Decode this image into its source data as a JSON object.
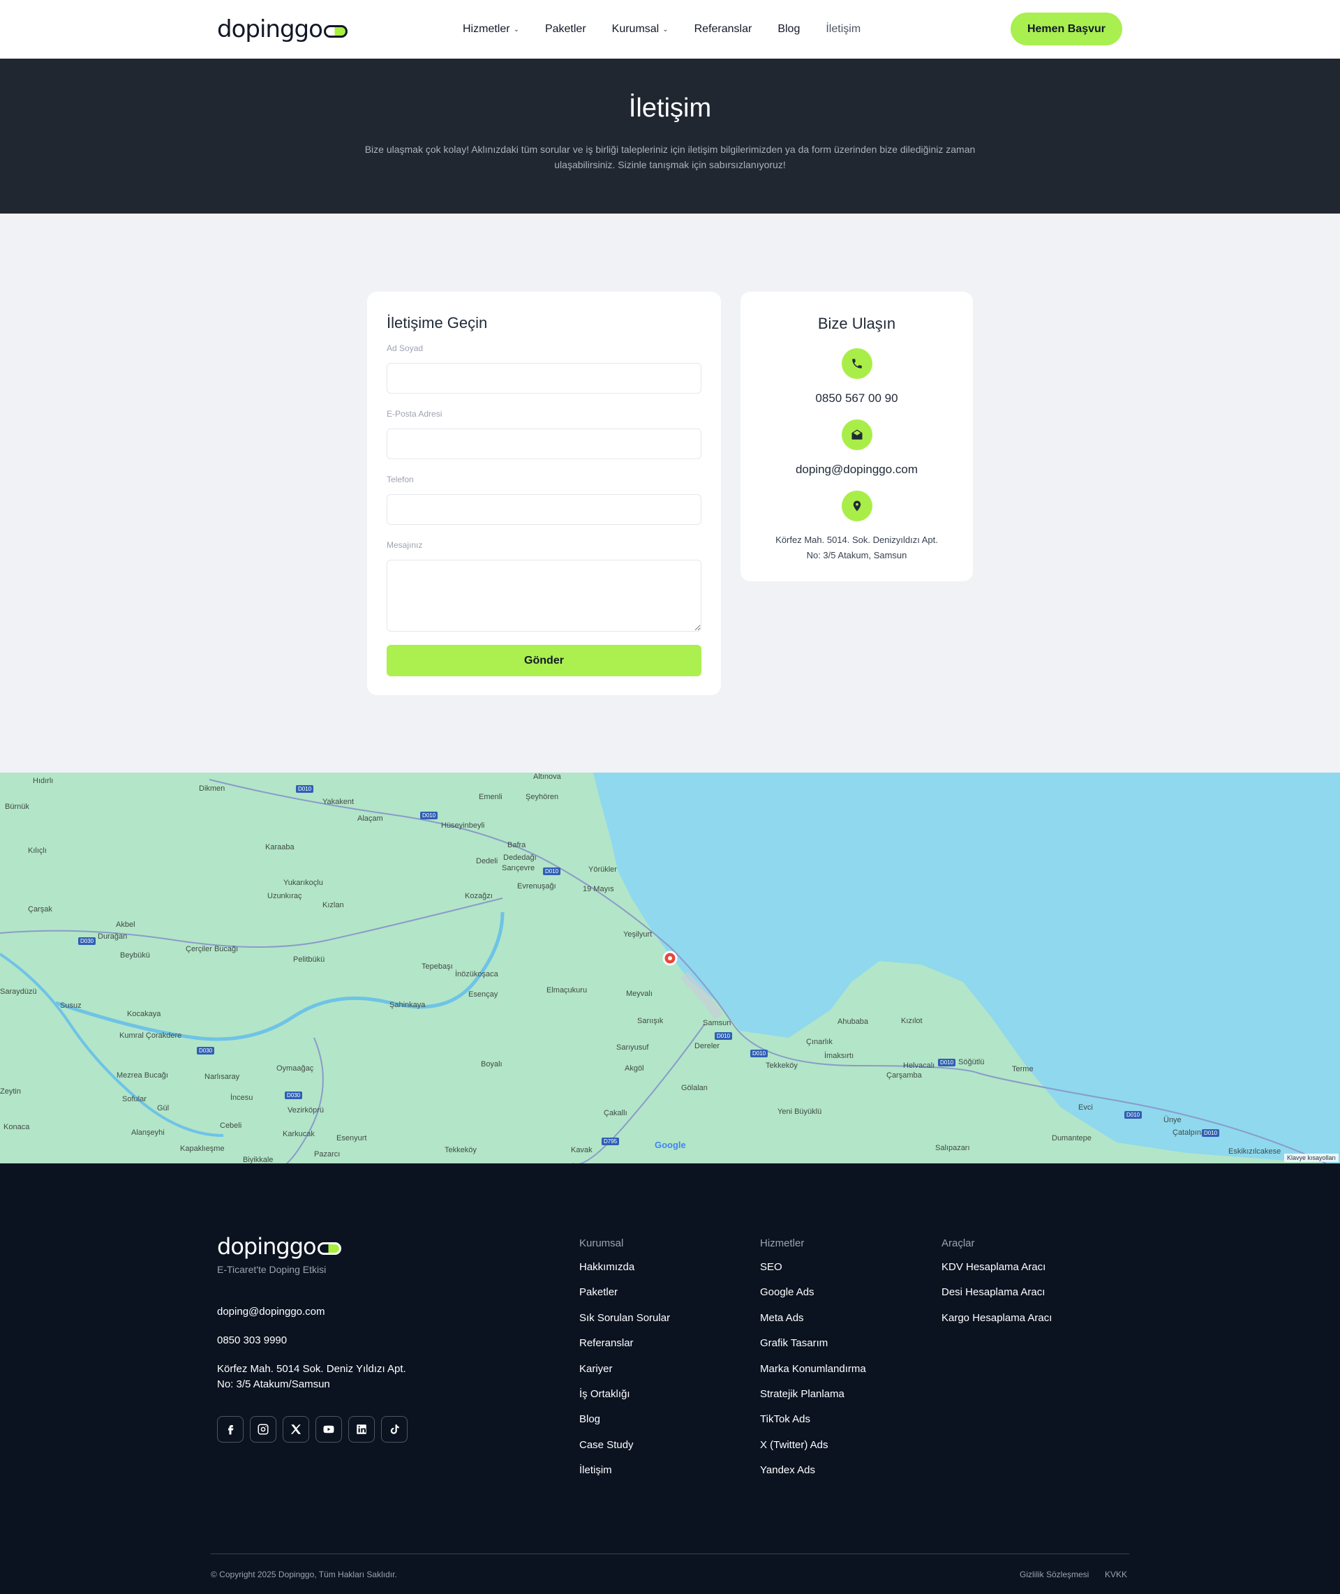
{
  "header": {
    "logo": "dopinggo",
    "nav": [
      {
        "label": "Hizmetler",
        "dropdown": true
      },
      {
        "label": "Paketler",
        "dropdown": false
      },
      {
        "label": "Kurumsal",
        "dropdown": true
      },
      {
        "label": "Referanslar",
        "dropdown": false
      },
      {
        "label": "Blog",
        "dropdown": false
      },
      {
        "label": "İletişim",
        "dropdown": false,
        "active": true
      }
    ],
    "cta": "Hemen Başvur"
  },
  "hero": {
    "title": "İletişim",
    "text": "Bize ulaşmak çok kolay! Aklınızdaki tüm sorular ve iş birliği talepleriniz için iletişim bilgilerimizden ya da form üzerinden bize dilediğiniz zaman ulaşabilirsiniz. Sizinle tanışmak için sabırsızlanıyoruz!"
  },
  "form": {
    "title": "İletişime Geçin",
    "name_label": "Ad Soyad",
    "email_label": "E-Posta Adresi",
    "phone_label": "Telefon",
    "message_label": "Mesajınız",
    "submit": "Gönder"
  },
  "contact": {
    "title": "Bize Ulaşın",
    "phone": "0850 567 00 90",
    "email": "doping@dopinggo.com",
    "address_line1": "Körfez Mah. 5014. Sok. Denizyıldızı Apt.",
    "address_line2": "No: 3/5 Atakum, Samsun"
  },
  "map": {
    "labels": [
      "Altınova",
      "Dikmen",
      "Hıdırlı",
      "Yakakent",
      "Emenli",
      "Şeyhören",
      "Bürnük",
      "Alaçam",
      "Hüseyinbeyli",
      "Kılıçlı",
      "Karaaba",
      "Bafra",
      "Dedeli",
      "Dededağı",
      "Sarıçevre",
      "Yörükler",
      "Yukarıkoçlu",
      "Uzunkıraç",
      "Evrenuşağı",
      "19 Mayıs",
      "Kozağzı",
      "Kızlan",
      "Çarşak",
      "Akbel",
      "Durağan",
      "Yeşilyurt",
      "Beybükü",
      "Çerçiler Bucağı",
      "Pelitbükü",
      "Tepebaşı",
      "İnözükoşaca",
      "Elmaçukuru",
      "Meyvalı",
      "Esençay",
      "Şahinkaya",
      "Saraydüzü",
      "Susuz",
      "Kocakaya",
      "Sarıışık",
      "Samsun",
      "Ahubaba",
      "Kızılot",
      "Kumral Çorakdere",
      "Sarıyusuf",
      "Dereler",
      "Çınarlık",
      "İmaksırtı",
      "Mezrea Bucağı",
      "Narlısaray",
      "Oymaağaç",
      "Boyalı",
      "Akgöl",
      "Tekkeköy",
      "Helvacalı",
      "Söğütlü",
      "Terme",
      "Çarşamba",
      "Sofular",
      "İncesu",
      "Gölalan",
      "Gül",
      "Vezirköprü",
      "Evci",
      "Ünye",
      "Konaca",
      "Alanşeyhi",
      "Cebeli",
      "Çakallı",
      "Yeni Büyüklü",
      "Dumantepe",
      "Çatalpınar",
      "Karkucak",
      "Esenyurt",
      "Kapaklıeşme",
      "Tekkeköy",
      "Kavak",
      "Pazarcı",
      "Salıpazarı",
      "Eskikızılcakese",
      "Zeytin",
      "Biyikkale"
    ],
    "google": "Google",
    "keyboard": "Klavye kısayolları"
  },
  "footer": {
    "logo": "dopinggo",
    "tagline": "E-Ticaret'te Doping Etkisi",
    "email": "doping@dopinggo.com",
    "phone": "0850 303 9990",
    "address_line1": "Körfez Mah. 5014 Sok. Deniz Yıldızı Apt.",
    "address_line2": "No: 3/5 Atakum/Samsun",
    "socials": [
      "facebook-icon",
      "instagram-icon",
      "x-icon",
      "youtube-icon",
      "linkedin-icon",
      "tiktok-icon"
    ],
    "columns": [
      {
        "title": "Kurumsal",
        "links": [
          "Hakkımızda",
          "Paketler",
          "Sık Sorulan Sorular",
          "Referanslar",
          "Kariyer",
          "İş Ortaklığı",
          "Blog",
          "Case Study",
          "İletişim"
        ]
      },
      {
        "title": "Hizmetler",
        "links": [
          "SEO",
          "Google Ads",
          "Meta Ads",
          "Grafik Tasarım",
          "Marka Konumlandırma",
          "Stratejik Planlama",
          "TikTok Ads",
          "X (Twitter) Ads",
          "Yandex Ads"
        ]
      },
      {
        "title": "Araçlar",
        "links": [
          "KDV Hesaplama Aracı",
          "Desi Hesaplama Aracı",
          "Kargo Hesaplama Aracı"
        ]
      }
    ],
    "copyright": "© Copyright 2025 Dopinggo, Tüm Hakları Saklıdır.",
    "privacy": "Gizlilik Sözleşmesi",
    "kvkk": "KVKK"
  },
  "colors": {
    "accent": "#abf04f",
    "hero_bg": "#202731",
    "footer_bg": "#0b1321",
    "sea": "#8fd8ee",
    "land": "#b3e5c8"
  }
}
